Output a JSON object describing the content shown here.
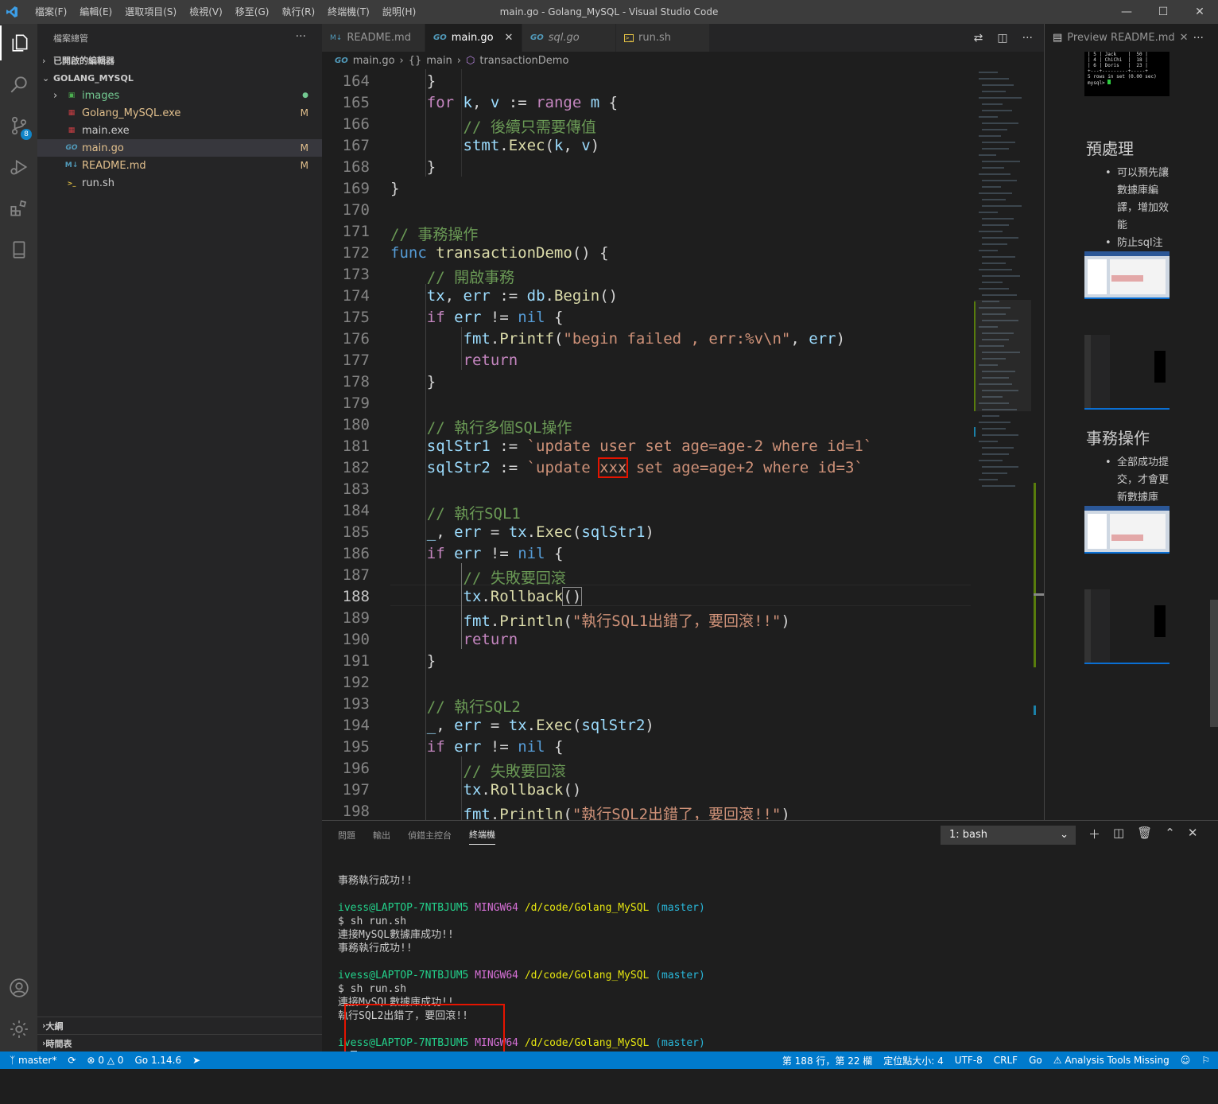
{
  "window": {
    "title": "main.go - Golang_MySQL - Visual Studio Code",
    "menus": [
      "檔案(F)",
      "編輯(E)",
      "選取項目(S)",
      "檢視(V)",
      "移至(G)",
      "執行(R)",
      "終端機(T)",
      "說明(H)"
    ]
  },
  "activity": {
    "scm_badge": "8"
  },
  "explorer": {
    "header": "檔案總管",
    "open_editors": "已開啟的編輯器",
    "folder": "GOLANG_MYSQL",
    "items": [
      {
        "name": "images",
        "status": "●",
        "icon": "folder-image-icon"
      },
      {
        "name": "Golang_MySQL.exe",
        "status": "M",
        "icon": "exe-file-icon"
      },
      {
        "name": "main.exe",
        "status": "",
        "icon": "exe-file-icon"
      },
      {
        "name": "main.go",
        "status": "M",
        "icon": "go-file-icon"
      },
      {
        "name": "README.md",
        "status": "M",
        "icon": "markdown-file-icon"
      },
      {
        "name": "run.sh",
        "status": "",
        "icon": "shell-file-icon"
      }
    ],
    "outline": "大綱",
    "timeline": "時間表"
  },
  "tabs": [
    {
      "label": "README.md",
      "icon_text": "M↓"
    },
    {
      "label": "main.go",
      "icon_text": "GO"
    },
    {
      "label": "sql.go",
      "icon_text": "GO"
    },
    {
      "label": "run.sh",
      "icon_text": ">_"
    }
  ],
  "breadcrumb": {
    "file": "main.go",
    "pkg": "main",
    "func": "transactionDemo",
    "go_icon": "GO",
    "pkg_icon": "{}"
  },
  "code_start_line": 164,
  "preview": {
    "tab": "Preview README.md",
    "mysql_lines": [
      "| 5 | Jack    |  50 |",
      "| 4 | ChiChi  |  18 |",
      "| 6 | Doris   |  23 |",
      "+---+---------+-----+",
      "5 rows in set (0.00 sec)",
      "",
      "mysql> "
    ],
    "h1": "預處理",
    "list1": [
      "可以預先讓數據庫編譯，增加效能",
      "防止sql注入"
    ],
    "h2": "事務操作",
    "list2": [
      "全部成功提交，才會更新數據庫"
    ]
  },
  "panel": {
    "tabs": [
      "問題",
      "輸出",
      "偵錯主控台",
      "終端機"
    ],
    "terminal_select": "1: bash",
    "prompt_user": "ivess@LAPTOP-7NTBJUM5",
    "prompt_sys": "MINGW64",
    "prompt_path": "/d/code/Golang_MySQL",
    "prompt_branch": "(master)",
    "lines": {
      "l1": "事務執行成功!!",
      "cmd": "$ sh run.sh",
      "conn": "連接MySQL數據庫成功!!",
      "ok": "事務執行成功!!",
      "err": "執行SQL2出錯了，要回滾!!",
      "dollar": "$ "
    }
  },
  "status": {
    "branch": "master*",
    "errors": "0",
    "warnings": "0",
    "go_version": "Go 1.14.6",
    "position": "第 188 行，第 22 欄",
    "indent": "定位點大小: 4",
    "encoding": "UTF-8",
    "eol": "CRLF",
    "language": "Go",
    "analysis": "Analysis Tools Missing"
  }
}
